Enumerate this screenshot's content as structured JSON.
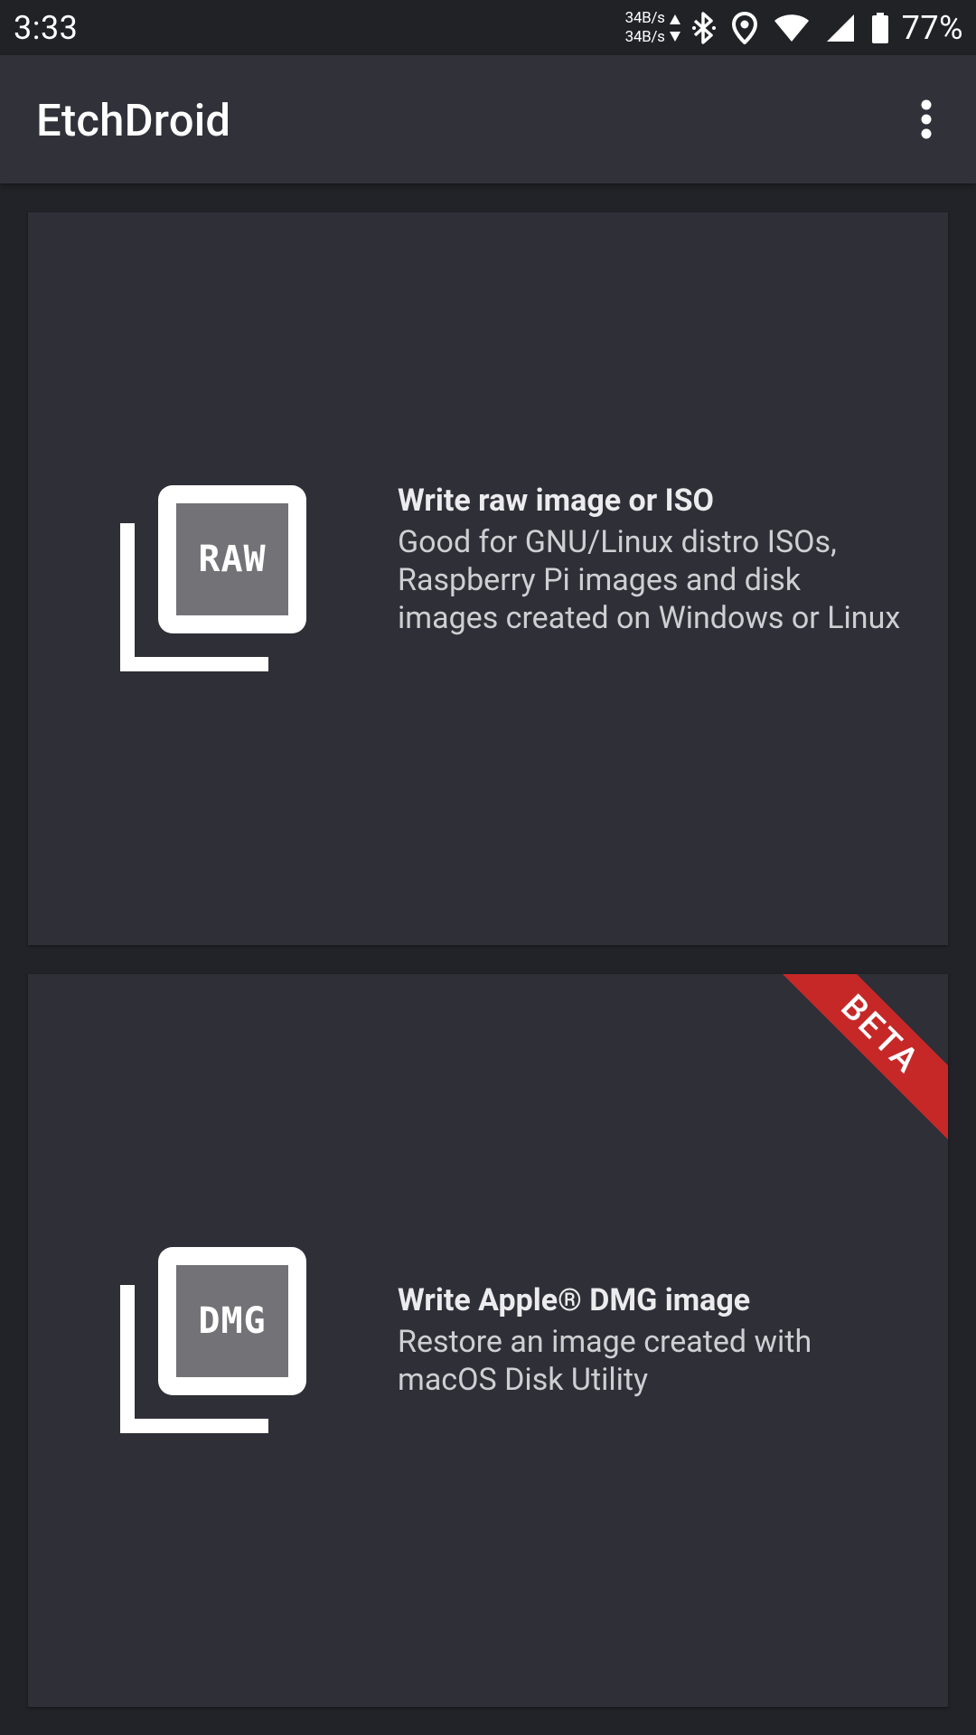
{
  "status_bar": {
    "time": "3:33",
    "net_up": "34B/s",
    "net_down": "34B/s",
    "battery": "77%",
    "icons": [
      "network-speed-arrows-icon",
      "bluetooth-icon",
      "location-icon",
      "wifi-icon",
      "cell-signal-icon",
      "battery-icon"
    ]
  },
  "app_bar": {
    "title": "EtchDroid",
    "overflow_icon": "more-vert-icon"
  },
  "cards": [
    {
      "icon_label": "RAW",
      "title": "Write raw image or ISO",
      "description": "Good for GNU/Linux distro ISOs, Raspberry Pi images and disk images created on Windows or Linux"
    },
    {
      "icon_label": "DMG",
      "title": "Write Apple® DMG image",
      "description": "Restore an image created with macOS Disk Utility",
      "badge": "BETA"
    }
  ],
  "colors": {
    "background": "#222328",
    "app_bar": "#303139",
    "card": "#2f2f37",
    "beta_badge": "#c62828",
    "icon_fill": "#737276"
  }
}
